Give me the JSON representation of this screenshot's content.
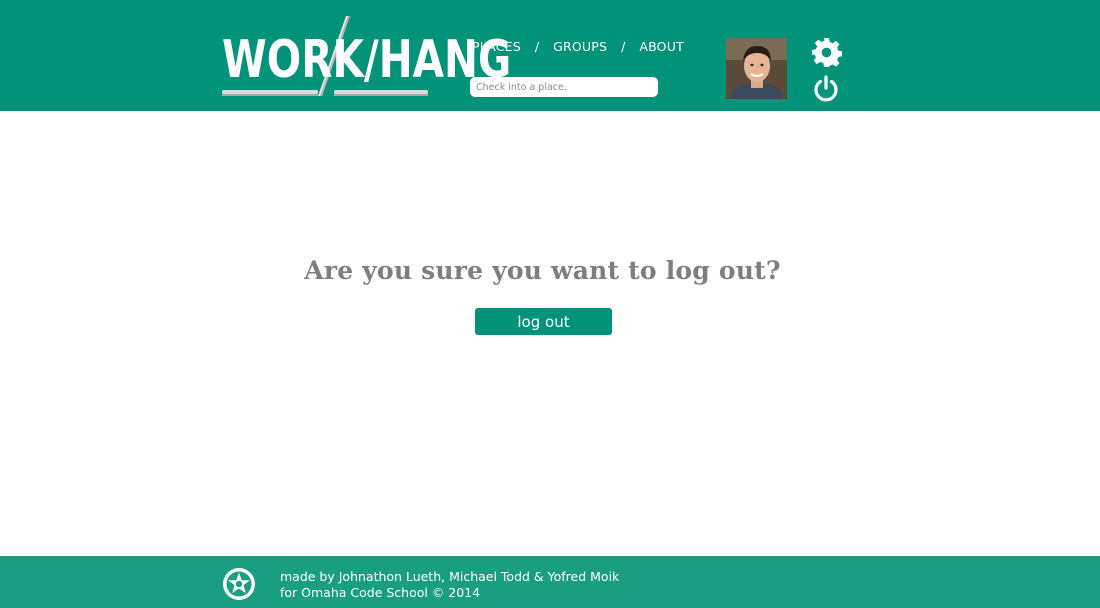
{
  "header": {
    "logo_text": "WORK/HANG",
    "nav": [
      {
        "label": "PLACES"
      },
      {
        "label": "GROUPS"
      },
      {
        "label": "ABOUT"
      }
    ],
    "nav_separator": "/",
    "search": {
      "placeholder": "Check into a place.",
      "value": ""
    },
    "icons": {
      "settings": "gear-icon",
      "logout": "power-icon"
    }
  },
  "main": {
    "question": "Are you sure you want to log out?",
    "button_label": "log out"
  },
  "footer": {
    "line1": "made by Johnathon Lueth, Michael Todd & Yofred Moik",
    "line2": "for Omaha Code School © 2014"
  },
  "colors": {
    "brand": "#009379",
    "footer": "#1a9e80",
    "question_text": "#7e7e7e"
  }
}
